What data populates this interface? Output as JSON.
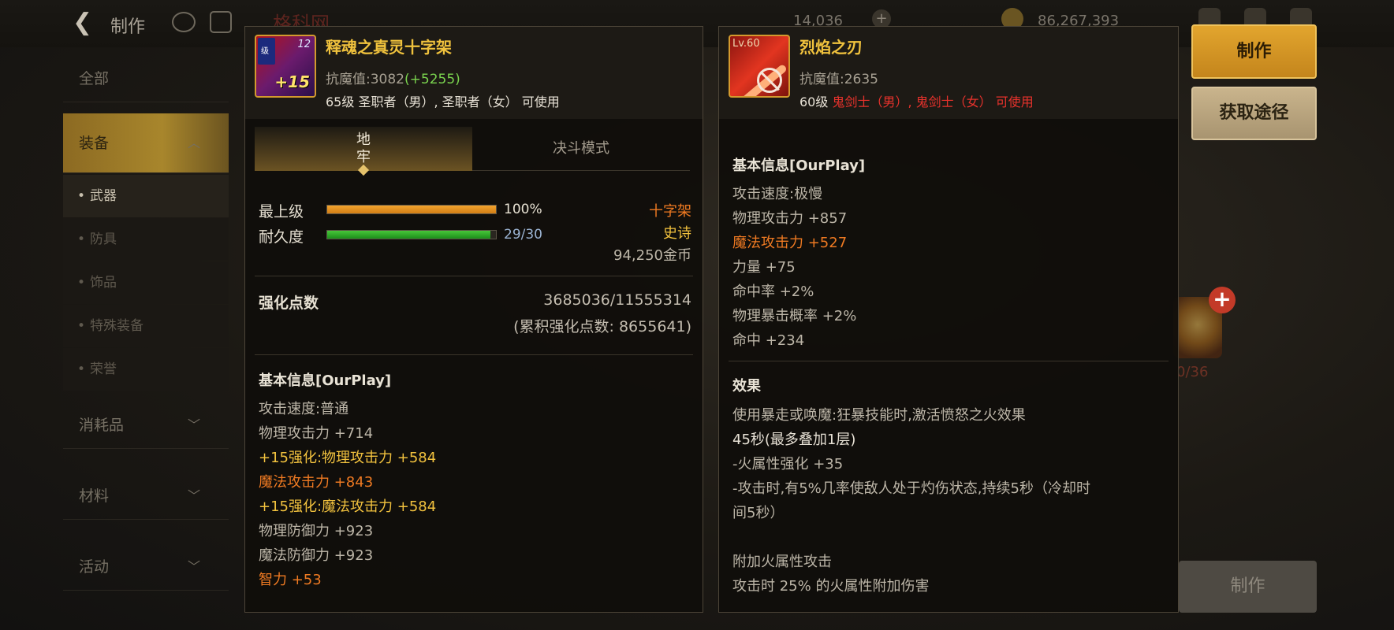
{
  "topbar": {
    "back_icon": "back-arrow-icon",
    "title": "制作",
    "watermark": "格科网",
    "currency_1": "14,036",
    "currency_2": "86,267,393"
  },
  "sidebar": {
    "items": [
      {
        "label": "全部"
      },
      {
        "label": "装备",
        "expanded": true
      },
      {
        "label": "武器",
        "sub": true,
        "active": true
      },
      {
        "label": "防具",
        "sub": true
      },
      {
        "label": "饰品",
        "sub": true
      },
      {
        "label": "特殊装备",
        "sub": true
      },
      {
        "label": "荣誉",
        "sub": true
      },
      {
        "label": "消耗品"
      },
      {
        "label": "材料"
      },
      {
        "label": "活动"
      }
    ]
  },
  "left_item": {
    "grade_label": "级",
    "level_badge": "12",
    "enhance_badge": "+15",
    "name": "释魂之真灵十字架",
    "anti_magic_label": "抗魔值:",
    "anti_magic_value": "3082",
    "anti_magic_bonus": "(+5255)",
    "usable": "65级 圣职者（男）, 圣职者（女） 可使用",
    "tabs": {
      "active": "地牢",
      "inactive": "决斗模式"
    },
    "grade_row": {
      "label": "最上级",
      "value": "100%",
      "fill": 1.0
    },
    "durability_row": {
      "label": "耐久度",
      "value": "29/30",
      "fill": 0.9667
    },
    "type": "十字架",
    "rarity": "史诗",
    "price": "94,250金币",
    "enhance_points_label": "强化点数",
    "enhance_points_value": "3685036/11555314",
    "enhance_points_total": "(累积强化点数: 8655641)",
    "basic_info_title": "基本信息[OurPlay]",
    "stats": [
      {
        "text": "攻击速度:普通",
        "color": "#bdb6a8"
      },
      {
        "text": "物理攻击力 +714",
        "color": "#bdb6a8"
      },
      {
        "text": "+15强化:物理攻击力 +584",
        "color": "#f2c23e"
      },
      {
        "text": "魔法攻击力 +843",
        "color": "#ef7a22"
      },
      {
        "text": "+15强化:魔法攻击力 +584",
        "color": "#f2c23e"
      },
      {
        "text": "物理防御力 +923",
        "color": "#bdb6a8"
      },
      {
        "text": "魔法防御力 +923",
        "color": "#bdb6a8"
      },
      {
        "text": "智力 +53",
        "color": "#ef7a22"
      }
    ]
  },
  "right_item": {
    "level_tag": "Lv.60",
    "name": "烈焰之刃",
    "anti_magic_label": "抗魔值:",
    "anti_magic_value": "2635",
    "usable_prefix": "60级 ",
    "usable_class": "鬼剑士（男）, 鬼剑士（女）",
    "usable_suffix": " 可使用",
    "basic_info_title": "基本信息[OurPlay]",
    "stats": [
      {
        "text": "攻击速度:极慢",
        "color": "#bdb6a8"
      },
      {
        "text": "物理攻击力 +857",
        "color": "#bdb6a8"
      },
      {
        "text": "魔法攻击力 +527",
        "color": "#ef7a22"
      },
      {
        "text": "力量 +75",
        "color": "#bdb6a8"
      },
      {
        "text": "命中率 +2%",
        "color": "#bdb6a8"
      },
      {
        "text": "物理暴击概率 +2%",
        "color": "#bdb6a8"
      },
      {
        "text": "命中 +234",
        "color": "#bdb6a8"
      }
    ],
    "effect_title": "效果",
    "effect_lines": [
      "使用暴走或唤魔:狂暴技能时,激活愤怒之火效果",
      "45秒(最多叠加1层)",
      "-火属性强化 +35",
      "-攻击时,有5%几率使敌人处于灼伤状态,持续5秒（冷却时",
      "间5秒）",
      "",
      "附加火属性攻击",
      "攻击时 25% 的火属性附加伤害"
    ]
  },
  "actions": {
    "craft": "制作",
    "get_source": "获取途径",
    "bottom_craft": "制作"
  },
  "material": {
    "count": "0/36"
  },
  "colors": {
    "gold_name": "#f0c23d",
    "orange_stat": "#ef7a22",
    "enhance_yellow": "#f2c23e",
    "bonus_green": "#7ad34e",
    "class_red": "#e8322c",
    "button_gold": "#d39426"
  }
}
